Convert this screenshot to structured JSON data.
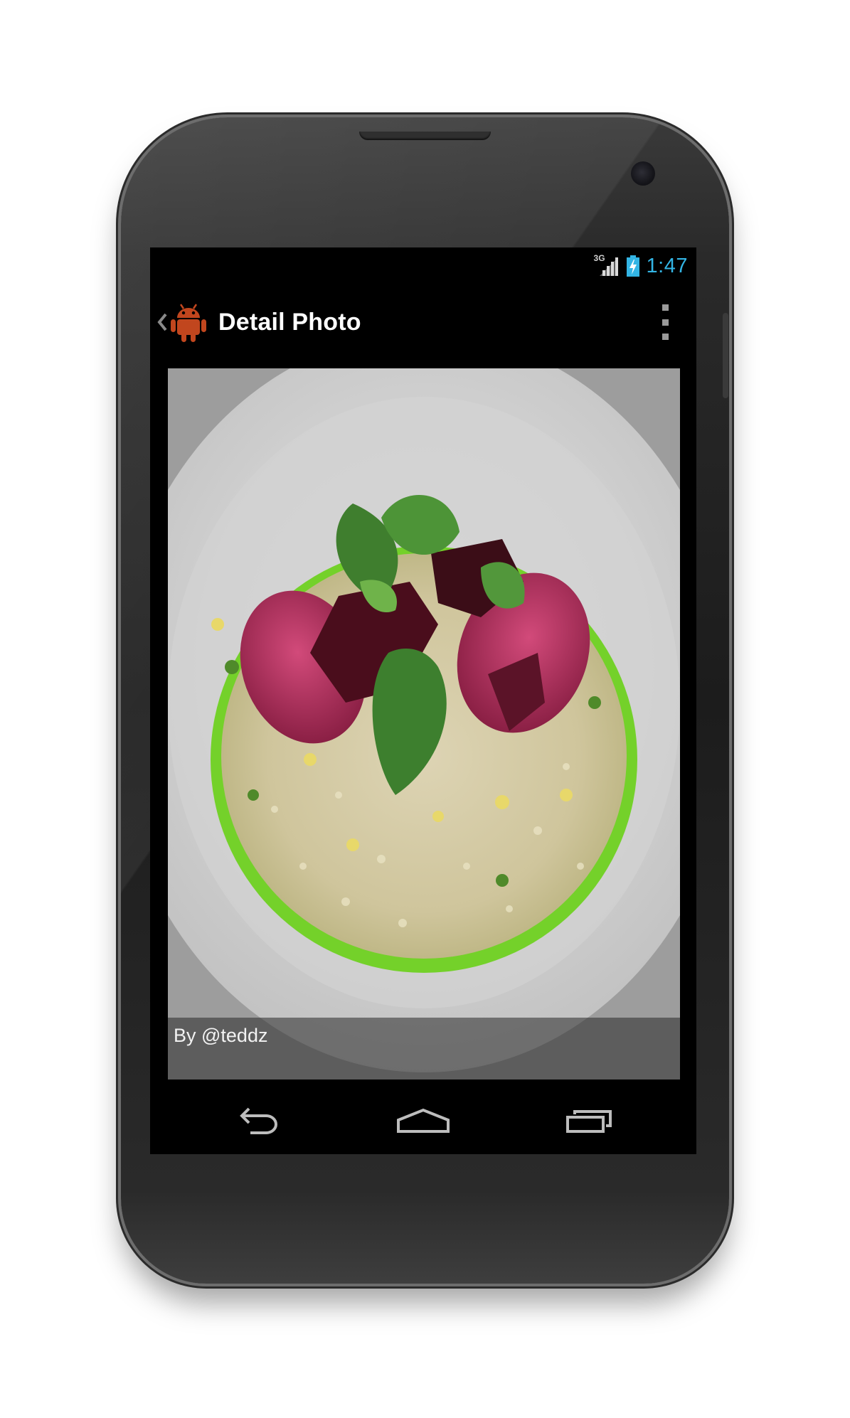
{
  "status_bar": {
    "network_type": "3G",
    "time": "1:47",
    "clock_color": "#33b5e5",
    "icons": [
      "signal-icon",
      "battery-charging-icon"
    ]
  },
  "action_bar": {
    "title": "Detail Photo",
    "icons": [
      "back-chevron-icon",
      "android-app-icon",
      "overflow-menu-icon"
    ],
    "app_icon_color": "#c1461e"
  },
  "photo": {
    "caption": "By @teddz",
    "image_description": "plated-risotto-photo"
  },
  "nav_bar": {
    "buttons": [
      "back-icon",
      "home-icon",
      "recent-apps-icon"
    ]
  }
}
